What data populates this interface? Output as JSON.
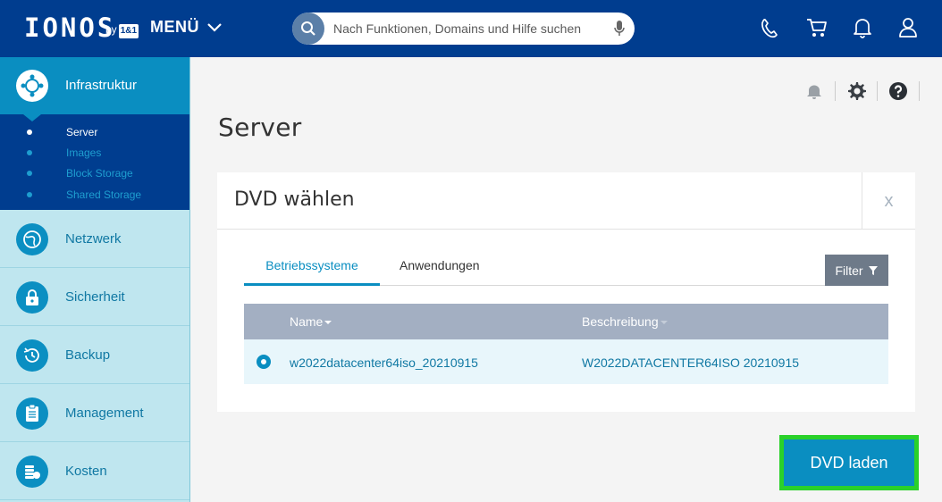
{
  "header": {
    "logo": "IONOS",
    "logo_by": "by",
    "logo_brand": "1&1",
    "menu_label": "MENÜ",
    "search_placeholder": "Nach Funktionen, Domains und Hilfe suchen",
    "icons": [
      "phone-icon",
      "cart-icon",
      "bell-icon",
      "user-icon"
    ]
  },
  "sidebar": {
    "active": {
      "label": "Infrastruktur",
      "icon": "infrastructure-icon"
    },
    "sub_items": [
      {
        "label": "Server",
        "active": true
      },
      {
        "label": "Images",
        "active": false
      },
      {
        "label": "Block Storage",
        "active": false
      },
      {
        "label": "Shared Storage",
        "active": false
      }
    ],
    "items": [
      {
        "label": "Netzwerk",
        "icon": "globe-icon"
      },
      {
        "label": "Sicherheit",
        "icon": "lock-icon"
      },
      {
        "label": "Backup",
        "icon": "history-icon"
      },
      {
        "label": "Management",
        "icon": "clipboard-icon"
      },
      {
        "label": "Kosten",
        "icon": "coins-icon"
      }
    ]
  },
  "main": {
    "page_title": "Server",
    "toolbar_icons": [
      "bell-icon",
      "gear-icon",
      "help-icon"
    ],
    "dialog": {
      "title": "DVD wählen",
      "close_label": "x",
      "tabs": [
        {
          "label": "Betriebssysteme",
          "active": true
        },
        {
          "label": "Anwendungen",
          "active": false
        }
      ],
      "filter_label": "Filter",
      "columns": [
        "Name",
        "Beschreibung"
      ],
      "rows": [
        {
          "name": "w2022datacenter64iso_20210915",
          "description": "W2022DATACENTER64ISO 20210915",
          "selected": true
        }
      ]
    },
    "load_button": "DVD laden"
  },
  "colors": {
    "header": "#003d8f",
    "accent": "#0a8ec1",
    "sidebar_bg": "#bfe6ef",
    "highlight": "#2ad12a"
  }
}
